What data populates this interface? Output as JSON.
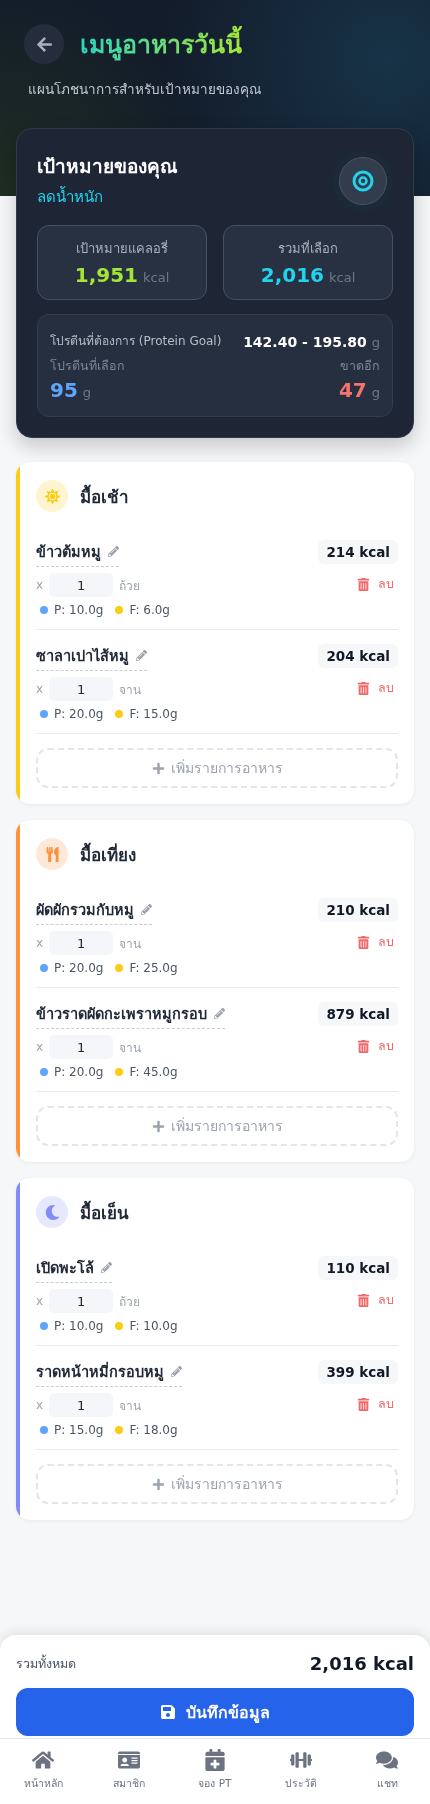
{
  "header": {
    "title": "เมนูอาหารวันนี้",
    "subtitle": "แผนโภชนาการสำหรับเป้าหมายของคุณ"
  },
  "goal": {
    "title": "เป้าหมายของคุณ",
    "goal_type": "ลดน้ำหนัก",
    "stats": [
      {
        "label": "เป้าหมายแคลอรี่",
        "value": "1,951",
        "unit": "kcal",
        "kind": "target"
      },
      {
        "label": "รวมที่เลือก",
        "value": "2,016",
        "unit": "kcal",
        "kind": "selected"
      }
    ],
    "protein": {
      "label": "โปรตีนที่ต้องการ (Protein Goal)",
      "range": "142.40 - 195.80",
      "range_unit": "g",
      "selected_label": "โปรตีนที่เลือก",
      "selected_value": "95",
      "selected_unit": "g",
      "missing_label": "ขาดอีก",
      "missing_value": "47",
      "missing_unit": "g"
    }
  },
  "meals": [
    {
      "title": "มื้อเช้า",
      "kind": "breakfast",
      "color": "#facc15",
      "add_label": "เพิ่มรายการอาหาร",
      "items": [
        {
          "name": "ข้าวต้มหมู",
          "kcal": "214 kcal",
          "x": "x",
          "qty": "1",
          "unit": "ถ้วย",
          "protein": "P: 10.0g",
          "fat": "F: 6.0g",
          "delete": "ลบ"
        },
        {
          "name": "ซาลาเปาไส้หมู",
          "kcal": "204 kcal",
          "x": "x",
          "qty": "1",
          "unit": "จาน",
          "protein": "P: 20.0g",
          "fat": "F: 15.0g",
          "delete": "ลบ"
        }
      ]
    },
    {
      "title": "มื้อเที่ยง",
      "kind": "lunch",
      "color": "#fb923c",
      "add_label": "เพิ่มรายการอาหาร",
      "items": [
        {
          "name": "ผัดผักรวมกับหมู",
          "kcal": "210 kcal",
          "x": "x",
          "qty": "1",
          "unit": "จาน",
          "protein": "P: 20.0g",
          "fat": "F: 25.0g",
          "delete": "ลบ"
        },
        {
          "name": "ข้าวราดผัดกะเพราหมูกรอบ",
          "kcal": "879 kcal",
          "x": "x",
          "qty": "1",
          "unit": "จาน",
          "protein": "P: 20.0g",
          "fat": "F: 45.0g",
          "delete": "ลบ"
        }
      ]
    },
    {
      "title": "มื้อเย็น",
      "kind": "dinner",
      "color": "#818cf8",
      "add_label": "เพิ่มรายการอาหาร",
      "items": [
        {
          "name": "เปิดพะโล้",
          "kcal": "110 kcal",
          "x": "x",
          "qty": "1",
          "unit": "ถ้วย",
          "protein": "P: 10.0g",
          "fat": "F: 10.0g",
          "delete": "ลบ"
        },
        {
          "name": "ราดหน้าหมี่กรอบหมู",
          "kcal": "399 kcal",
          "x": "x",
          "qty": "1",
          "unit": "จาน",
          "protein": "P: 15.0g",
          "fat": "F: 18.0g",
          "delete": "ลบ"
        }
      ]
    }
  ],
  "summary": {
    "label": "รวมทั้งหมด",
    "total": "2,016 kcal",
    "save_label": "บันทึกข้อมูล"
  },
  "nav": [
    {
      "label": "หน้าหลัก",
      "kind": "home"
    },
    {
      "label": "สมาชิก",
      "kind": "member"
    },
    {
      "label": "จอง PT",
      "kind": "booking"
    },
    {
      "label": "ประวัติ",
      "kind": "history"
    },
    {
      "label": "แชท",
      "kind": "chat"
    }
  ]
}
